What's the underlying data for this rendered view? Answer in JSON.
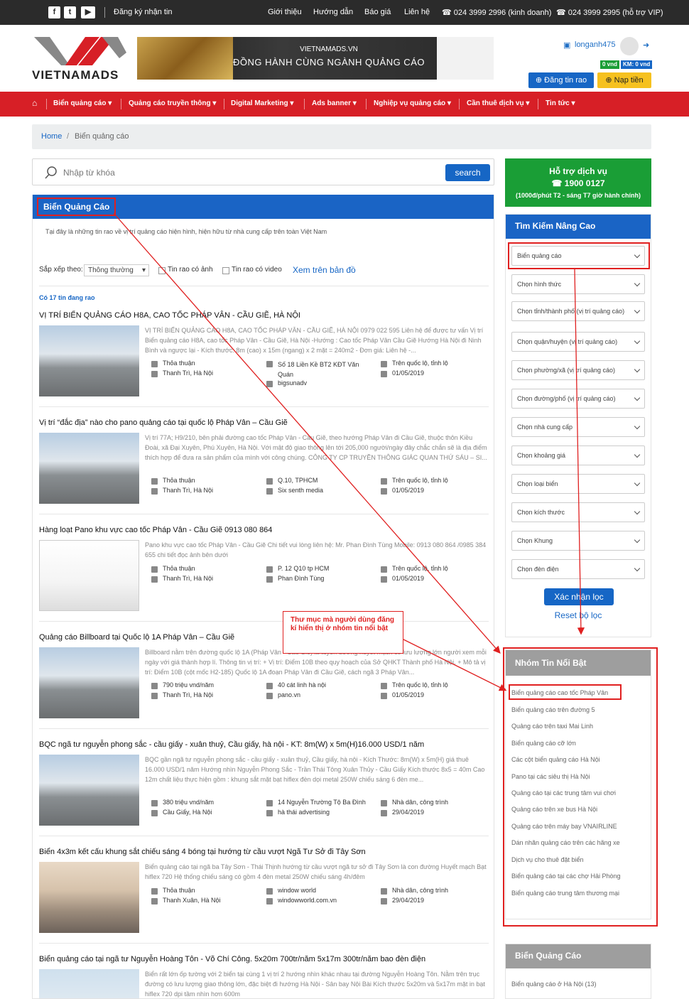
{
  "topbar": {
    "social": [
      "f",
      "t",
      "▶"
    ],
    "subscribe": "Đăng ký nhận tin",
    "links": [
      "Giới thiệu",
      "Hướng dẫn",
      "Báo giá",
      "Liên hệ"
    ],
    "phone_sales": "☎ 024 3999 2996 (kinh doanh)",
    "phone_vip": "☎ 024 3999 2995 (hỗ trợ VIP)"
  },
  "header": {
    "logo": "VIETNAMADS",
    "banner_line1": "VIETNAMADS.VN",
    "banner_line2": "ĐỒNG HÀNH CÙNG NGÀNH QUẢNG CÁO",
    "username": "longanh475",
    "balance": "0 vnd",
    "promo": "KM: 0 vnd",
    "post_button": "⊕ Đăng tin rao",
    "pay_button": "⊕ Nạp tiền"
  },
  "nav": {
    "items": [
      "Biển quảng cáo",
      "Quảng cáo truyền thông",
      "Digital Marketing",
      "Ads banner",
      "Nghiệp vụ quảng cáo",
      "Cần thuê dịch vụ",
      "Tin tức"
    ]
  },
  "breadcrumb": {
    "home": "Home",
    "sep": "/",
    "current": "Biển quảng cáo"
  },
  "search": {
    "placeholder": "Nhập từ khóa",
    "button": "search"
  },
  "main": {
    "title": "Biển Quảng Cáo",
    "description": "Tại đây là những tin rao về vị trí quảng cáo hiện hình, hiện hữu từ nhà cung cấp trên toàn Việt Nam",
    "sort_label": "Sắp xếp theo:",
    "sort_value": "Thông thường",
    "filter_image": "Tin rao có ảnh",
    "filter_video": "Tin rao có video",
    "map_link": "Xem trên bản đồ",
    "count": "Có 17 tin đang rao",
    "listings": [
      {
        "title": "VỊ TRÍ BIỂN QUẢNG CÁO H8A, CAO TỐC PHÁP VÂN - CẦU GIẼ, HÀ NỘI",
        "desc": "VỊ TRÍ BIỂN QUẢNG CÁO H8A, CAO TỐC PHÁP VÂN - CẦU GIẼ, HÀ NỘI 0979 022 595 Liên hệ để được tư vấn Vị trí Biển quảng cáo H8A, cao tốc Pháp Vân - Cầu Giẽ, Hà Nội -Hướng : Cao tốc Pháp Vân Cầu Giẽ Hướng Hà Nội đi Ninh Bình và ngược lại - Kích thước: 8m (cao) x 15m (ngang) x 2 mặt = 240m2 - Đơn giá: Liên hệ -...",
        "price": "Thỏa thuận",
        "loc": "Thanh Trì, Hà Nội",
        "addr": "Số 18 Liền Kề BT2 KĐT Văn Quán",
        "user": "bigsunadv",
        "type": "Trên quốc lộ, tỉnh lộ",
        "date": "01/05/2019"
      },
      {
        "title": "Vị trí “đắc địa” nào cho pano quảng cáo tại quốc lộ Pháp Vân – Cầu Giẽ",
        "desc": "Vị trí 77A; H9/210, bên phải đường cao tốc Pháp Vân - Cầu Giẽ, theo hướng Pháp Vân đi Cầu Giẽ, thuộc thôn Kiều Đoài, xã Đại Xuyên, Phú Xuyên, Hà Nội. Với mật độ giao thông lên tới 205,000 người/ngày đây chắc chắn sẽ là địa điểm thích hợp để đưa ra sản phẩm của mình với công chúng. CÔNG TY CP TRUYỀN THÔNG GIÁC QUAN THỨ SÁU – SI...",
        "price": "Thỏa thuận",
        "loc": "Thanh Trì, Hà Nội",
        "addr": "Q.10, TPHCM",
        "user": "Six senth media",
        "type": "Trên quốc lộ, tỉnh lộ",
        "date": "01/05/2019"
      },
      {
        "title": "Hàng loạt Pano khu vực cao tốc Pháp Vân - Cầu Giẽ 0913 080 864",
        "desc": "Pano khu vực cao tốc Pháp Vân - Cầu Giẽ Chi tiết vui lòng liên hệ: Mr. Phan Đình Tùng Mobile: 0913 080 864 /0985 384 655 chi tiết đọc ảnh bên dưới",
        "price": "Thỏa thuận",
        "loc": "Thanh Trì, Hà Nội",
        "addr": "P. 12 Q10 tp HCM",
        "user": "Phan Đình Tùng",
        "type": "Trên quốc lộ, tỉnh lộ",
        "date": "01/05/2019"
      },
      {
        "title": "Quảng cáo Billboard tại Quốc lộ 1A Pháp Vân – Cầu Giẽ",
        "desc": "Billboard nằm trên đường quốc lộ 1A (Pháp Vân - Cầu Giẽ) là tuyến đường huyết mạch có lưu lượng lớn người xem mỗi ngày với giá thành hợp lí. Thông tin vị trí: + Vị trí: Điểm 10B theo quy hoạch của Sở QHKT Thành phố Hà Nội. + Mô tả vị trí: Điểm 10B (cột mốc H2-185) Quốc lộ 1A đoạn Pháp Vân đi Cầu Giẽ, cách ngã 3 Pháp Vân...",
        "price": "790 triệu vnd/năm",
        "loc": "Thanh Trì, Hà Nội",
        "addr": "40 cát linh hà nội",
        "user": "pano.vn",
        "type": "Trên quốc lộ, tỉnh lộ",
        "date": "01/05/2019"
      },
      {
        "title": "BQC ngã tư nguyễn phong sắc - cầu giấy - xuân thuỷ, Cầu giấy, hà nội - KT: 8m(W) x 5m(H)16.000 USD/1 năm",
        "desc": "BQC gần ngã tư nguyễn phong sắc - cầu giấy - xuân thuỷ, Cầu giấy, hà nội - Kích Thước: 8m(W) x 5m(H) giá thuê 16.000 USD/1 năm Hướng nhìn Nguyễn Phong Sắc - Trần Thái Tông Xuân Thủy - Cầu Giấy Kích thước 8x5 = 40m Cao 12m chất liệu thực hiện gồm : khung sắt mặt bạt hiflex đèn dọi metal 250W chiếu sáng 6 đèn me...",
        "price": "380 triệu vnd/năm",
        "loc": "Cầu Giấy, Hà Nội",
        "addr": "14 Nguyễn Trường Tộ Ba Đình",
        "user": "hà thái advertising",
        "type": "Nhà dân, công trình",
        "date": "29/04/2019"
      },
      {
        "title": "Biển 4x3m kết cấu khung sắt chiếu sáng 4 bóng tại hướng từ cầu vượt Ngã Tư Sở đi Tây Sơn",
        "desc": "Biển quảng cáo tại ngã ba Tây Sơn - Thái Thịnh hướng từ cầu vượt ngã tư sở đi Tây Sơn là con đường Huyết mạch Bạt hiflex 720 Hệ thống chiếu sáng có gồm 4 đèn metal 250W chiếu sáng 4h/đêm",
        "price": "Thỏa thuận",
        "loc": "Thanh Xuân, Hà Nội",
        "addr": "window world",
        "user": "windowworld.com.vn",
        "type": "Nhà dân, công trình",
        "date": "29/04/2019"
      },
      {
        "title": "Biển quảng cáo tại ngã tư Nguyễn Hoàng Tôn - Võ Chí Công. 5x20m 700tr/năm 5x17m 300tr/năm bao đèn điện",
        "desc": "Biển rất lớn ốp tường với 2 biển tại cùng 1 vị trí 2 hướng nhìn khác nhau tại đường Nguyễn Hoàng Tôn. Nằm trên trục đường có lưu lượng giao thông lớn, đặc biệt đi hướng Hà Nội - Sân bay Nội Bài Kích thước 5x20m và 5x17m mặt in bạt hiflex 720 dpi tầm nhìn hơn 600m",
        "price": "",
        "loc": "",
        "addr": "",
        "user": "",
        "type": "",
        "date": ""
      }
    ]
  },
  "support": {
    "title": "Hỗ trợ dịch vụ",
    "phone": "☎ 1900 0127",
    "note": "(1000đ/phút T2 - sáng T7 giờ hành chính)"
  },
  "advanced": {
    "title": "Tìm Kiếm Nâng Cao",
    "dropdowns": [
      "Biển quảng cáo",
      "Chọn hình thức",
      "Chọn tỉnh/thành phố (vị trí quảng cáo)",
      "Chọn quận/huyện (vị trí quảng cáo)",
      "Chọn phường/xã (vị trí quảng cáo)",
      "Chọn đường/phố (vị trí quảng cáo)",
      "Chọn nhà cung cấp",
      "Chọn khoảng giá",
      "Chọn loại biển",
      "Chọn kích thước",
      "Chọn Khung",
      "Chọn đèn điện"
    ],
    "apply": "Xác nhận lọc",
    "reset": "Reset bộ lọc"
  },
  "featured": {
    "title": "Nhóm Tin Nổi Bật",
    "items": [
      "Biển quảng cáo cao tốc Pháp Vân",
      "Biển quảng cáo trên đường 5",
      "Quảng cáo trên taxi Mai Linh",
      "Biển quảng cáo cỡ lớn",
      "Các cột biển quảng cáo Hà Nội",
      "Pano tại các siêu thị Hà Nội",
      "Quảng cáo tại các trung tâm vui chơi",
      "Quảng cáo trên xe bus Hà Nội",
      "Quảng cáo trên máy bay VNAIRLINE",
      "Dán nhãn quảng cáo trên các hãng xe",
      "Dịch vụ cho thuê đặt biển",
      "Biển quảng cáo tại các chợ Hải Phòng",
      "Biển quảng cáo trung tâm thương mại"
    ]
  },
  "category": {
    "title": "Biển Quảng Cáo",
    "item": "Biển quảng cáo ở Hà Nội (13)"
  },
  "annotation": {
    "note": "Thư mục mà người dùng đăng kí hiển thị ở nhóm tin nổi bật"
  },
  "colors": {
    "blue": "#1a64c5",
    "red": "#d71f26",
    "green": "#1a9e36",
    "annotation": "#e02020"
  }
}
